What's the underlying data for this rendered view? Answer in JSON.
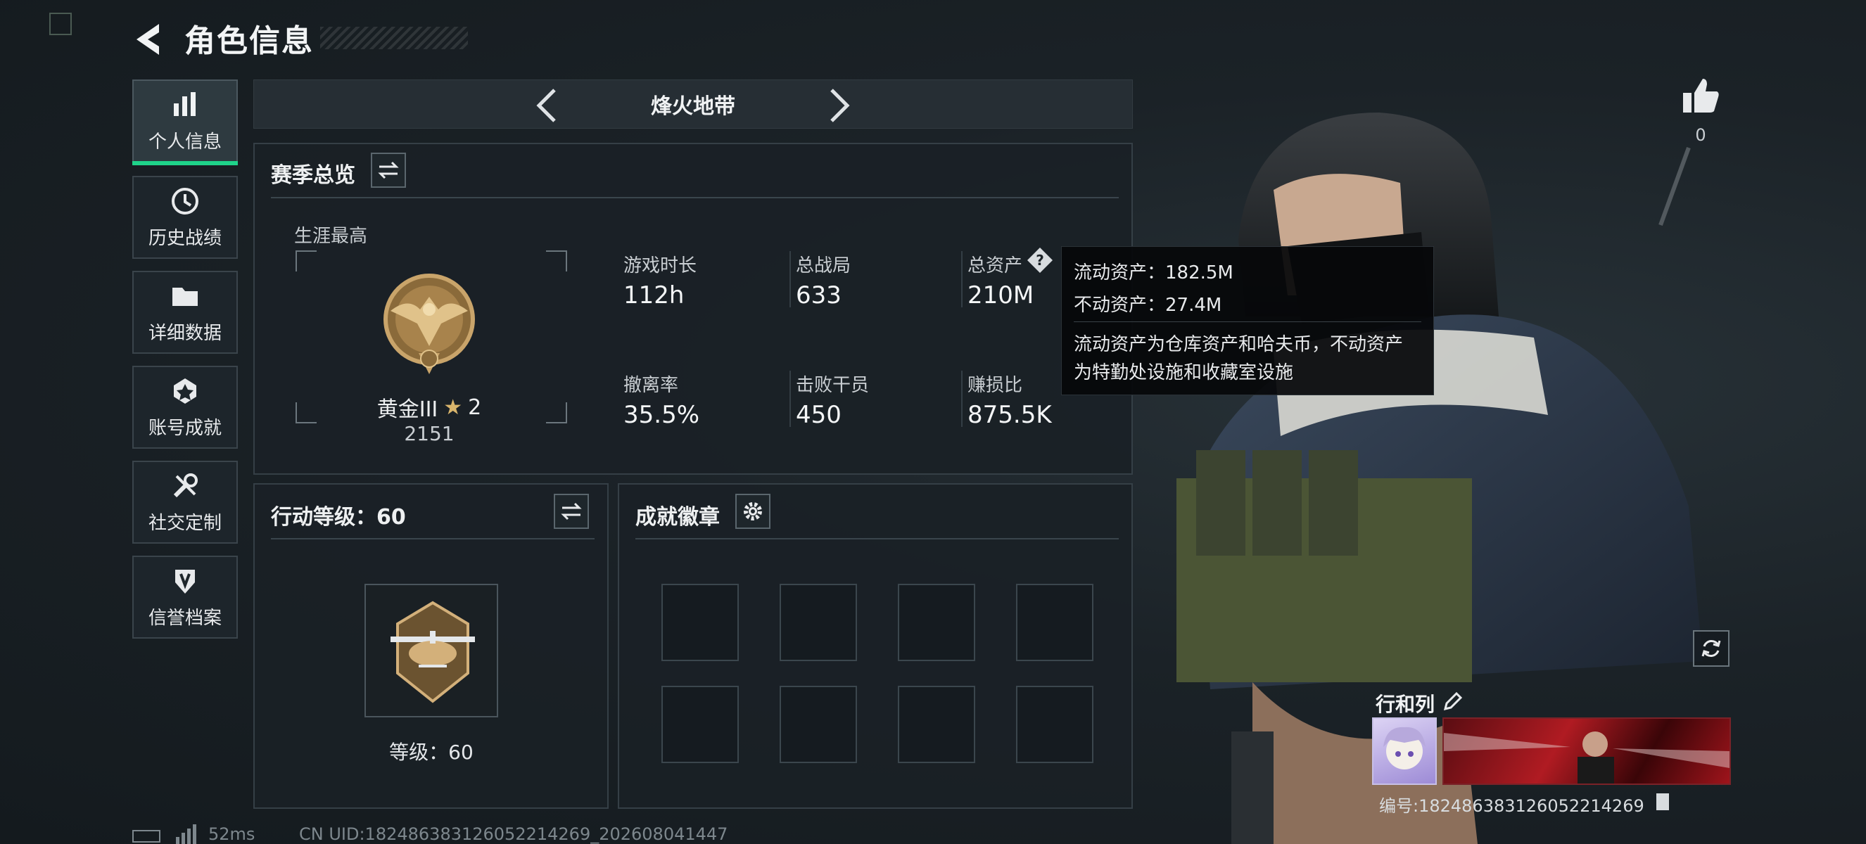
{
  "header": {
    "title": "角色信息"
  },
  "sidebar": {
    "items": [
      {
        "label": "个人信息",
        "icon": "bar-chart-icon",
        "active": true
      },
      {
        "label": "历史战绩",
        "icon": "history-icon"
      },
      {
        "label": "详细数据",
        "icon": "folder-icon"
      },
      {
        "label": "账号成就",
        "icon": "medal-icon"
      },
      {
        "label": "社交定制",
        "icon": "wrench-icon"
      },
      {
        "label": "信誉档案",
        "icon": "shield-icon"
      }
    ]
  },
  "mode": {
    "title": "烽火地带"
  },
  "season": {
    "title": "赛季总览",
    "career_label": "生涯最高",
    "rank_name": "黄金III",
    "rank_stars": "2",
    "rank_score": "2151",
    "stats": [
      {
        "label": "游戏时长",
        "value": "112h"
      },
      {
        "label": "总战局",
        "value": "633"
      },
      {
        "label": "总资产",
        "value": "210M"
      },
      {
        "label": "撤离率",
        "value": "35.5%"
      },
      {
        "label": "击败干员",
        "value": "450"
      },
      {
        "label": "赚损比",
        "value": "875.5K"
      }
    ]
  },
  "tooltip": {
    "liquid": "流动资产：182.5M",
    "fixed": "不动资产：27.4M",
    "desc_1": "流动资产为仓库资产和哈夫币，不动资产",
    "desc_2": "为特勤处设施和收藏室设施"
  },
  "action_level": {
    "title": "行动等级：60",
    "level_label": "等级：60"
  },
  "achievements": {
    "title": "成就徽章",
    "slots": 8
  },
  "status": {
    "ping": "52ms",
    "uid": "CN UID:18248638312605221426​9_202608041447"
  },
  "likes": {
    "count": "0"
  },
  "profile": {
    "name": "行和列",
    "id": "编号:182486383126052214269"
  },
  "colors": {
    "accent": "#1fd38a",
    "panel": "#1a2126",
    "border": "#353f46"
  }
}
